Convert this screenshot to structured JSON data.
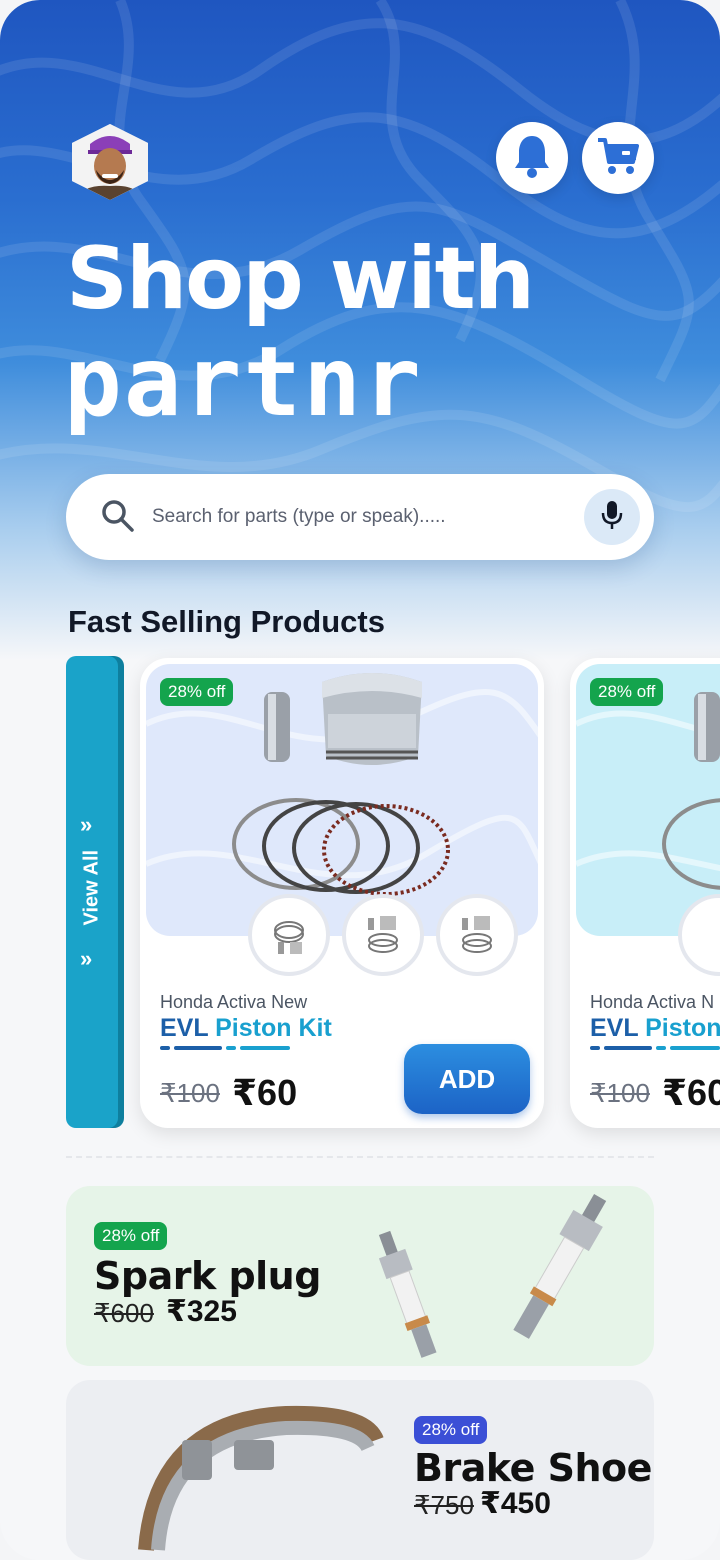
{
  "header": {
    "title": "Shop with",
    "brand": "partnr",
    "avatar_icon": "user-avatar",
    "notification_icon": "bell-icon",
    "cart_icon": "cart-icon"
  },
  "search": {
    "placeholder": "Search for parts (type or speak).....",
    "value": "",
    "search_icon": "search-icon",
    "mic_icon": "mic-icon"
  },
  "fast_selling": {
    "title": "Fast Selling Products",
    "view_all_label": "View All",
    "products": [
      {
        "discount": "28% off",
        "model": "Honda Activa New",
        "name_part1": "EVL",
        "name_part2": "Piston Kit",
        "old_price": "₹100",
        "new_price": "₹60",
        "add_label": "ADD"
      },
      {
        "discount": "28% off",
        "model": "Honda Activa N",
        "name_part1": "EVL",
        "name_part2": "Piston",
        "old_price": "₹100",
        "new_price": "₹60"
      }
    ]
  },
  "promos": [
    {
      "discount": "28% off",
      "name": "Spark plug",
      "old_price": "₹600",
      "new_price": "₹325"
    },
    {
      "discount": "28% off",
      "name": "Brake Shoe",
      "old_price": "₹750",
      "new_price": "₹450"
    }
  ],
  "colors": {
    "primary": "#1f56c0",
    "accent_teal": "#1aa3c9",
    "discount_green": "#14a44d",
    "discount_indigo": "#3b4fd6"
  }
}
